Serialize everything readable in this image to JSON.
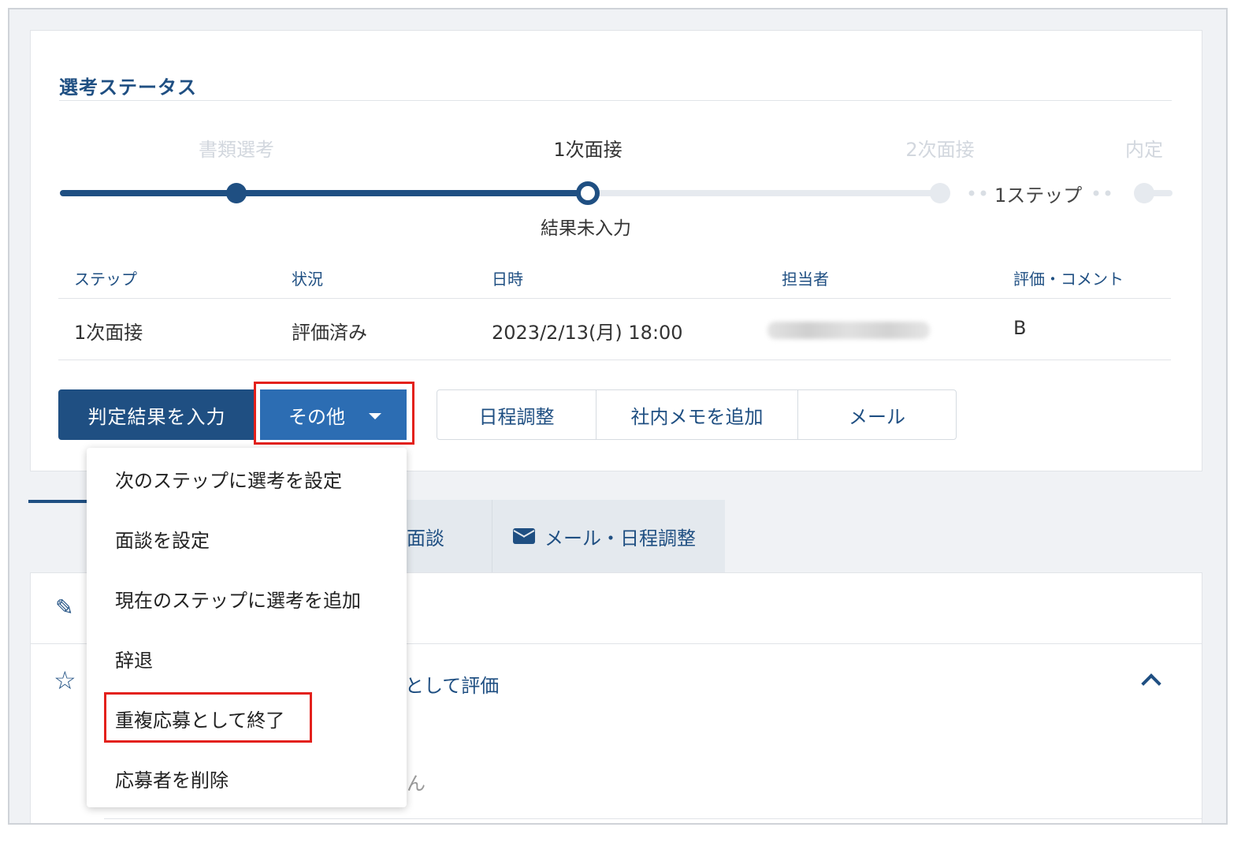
{
  "section_title": "選考ステータス",
  "progress": {
    "steps": [
      {
        "label": "書類選考",
        "state": "done"
      },
      {
        "label": "1次面接",
        "state": "current"
      },
      {
        "label": "2次面接",
        "state": "future"
      },
      {
        "label": "内定",
        "state": "future"
      }
    ],
    "skip_label": "1ステップ",
    "current_result": "結果未入力"
  },
  "table": {
    "headers": [
      "ステップ",
      "状況",
      "日時",
      "担当者",
      "評価・コメント"
    ],
    "rows": [
      {
        "step": "1次面接",
        "status": "評価済み",
        "datetime": "2023/2/13(月) 18:00",
        "assignee": "",
        "rating": "B"
      }
    ]
  },
  "buttons": {
    "primary": "判定結果を入力",
    "other": "その他",
    "group": [
      "日程調整",
      "社内メモを追加",
      "メール"
    ]
  },
  "dropdown": {
    "items": [
      "次のステップに選考を設定",
      "面談を設定",
      "現在のステップに選考を追加",
      "辞退",
      "重複応募として終了",
      "応募者を削除"
    ],
    "highlighted_index": 4
  },
  "tabs": {
    "interview_partial": "面談",
    "mail_schedule": "メール・日程調整"
  },
  "lower": {
    "evaluation_partial": "として評価",
    "ghost_text": "ん"
  },
  "colors": {
    "primary": "#1f4f82",
    "secondary_button": "#2c6db3",
    "highlight": "#e3211c"
  },
  "icons": [
    "pencil-icon",
    "star-icon",
    "mail-icon",
    "chevron-up-icon",
    "caret-down-icon"
  ]
}
